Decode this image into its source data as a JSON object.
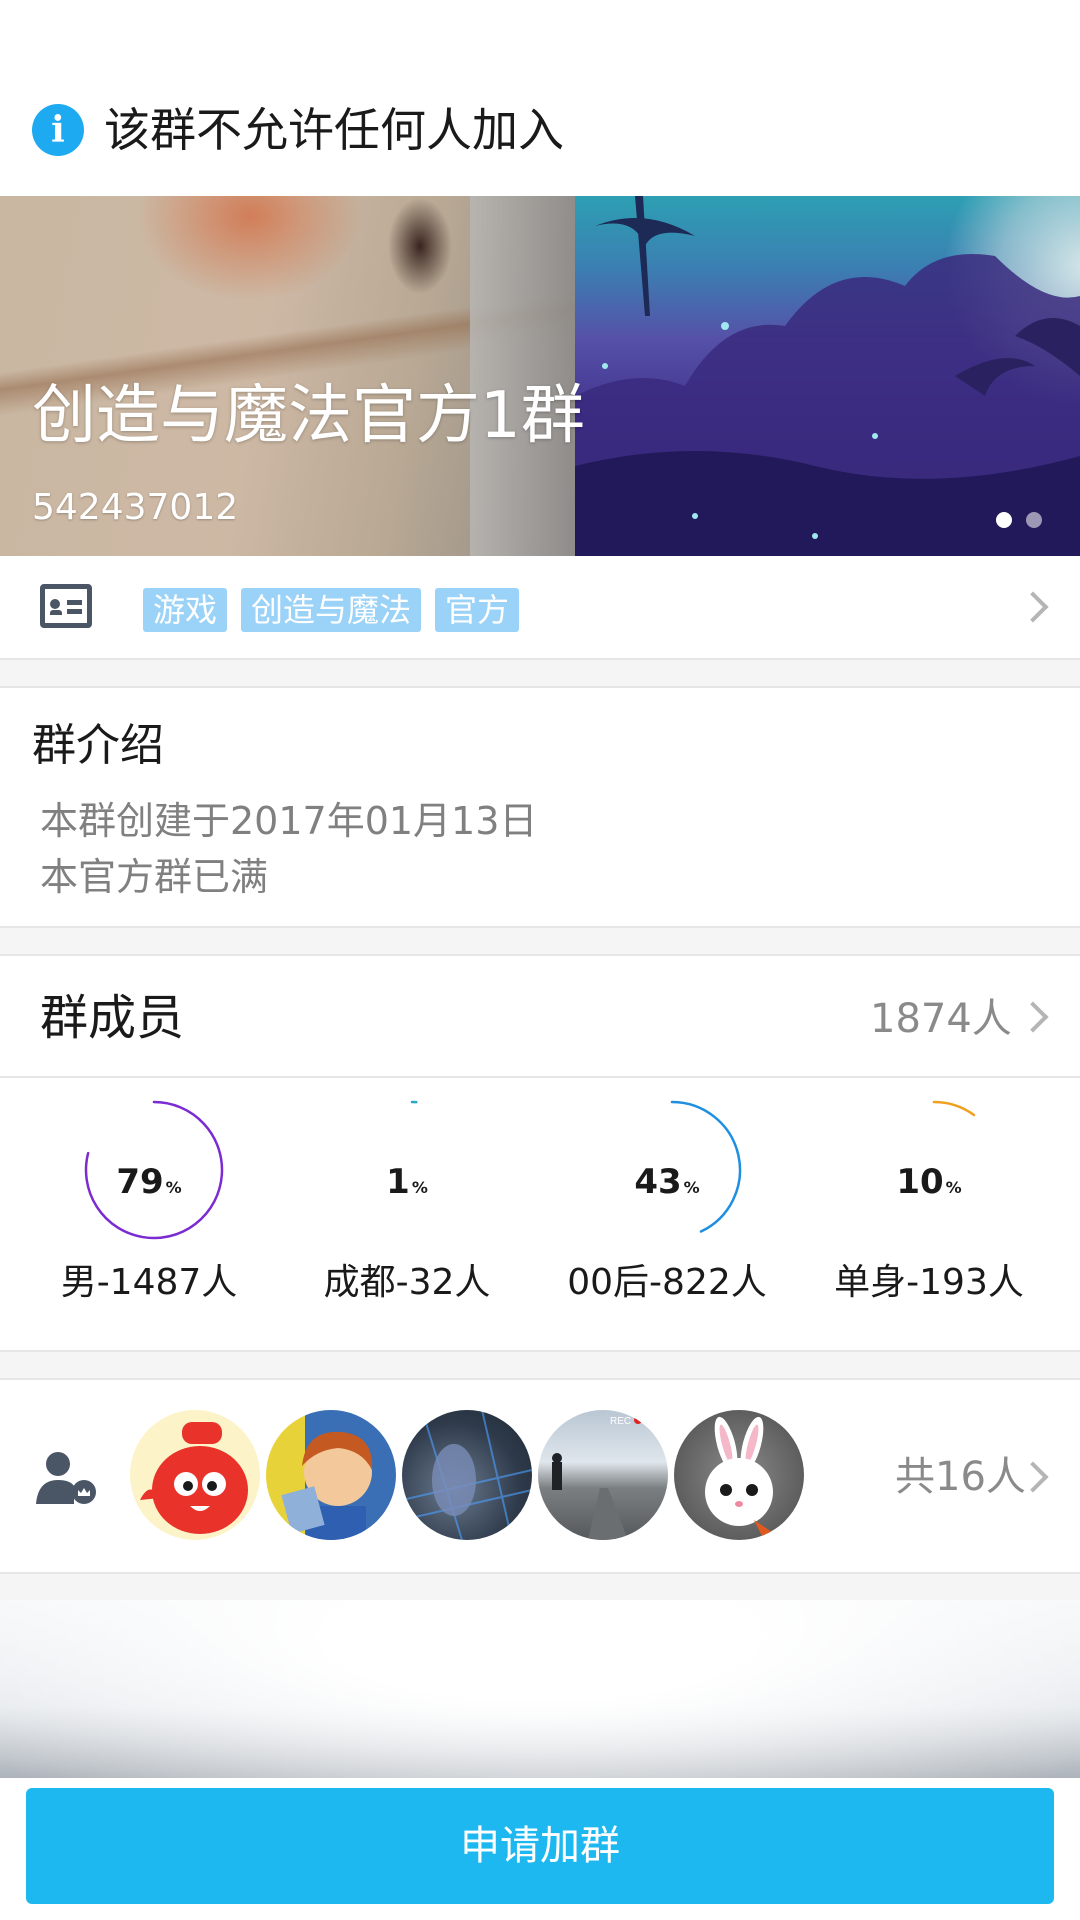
{
  "notice": {
    "icon": "info-icon",
    "text": "该群不允许任何人加入"
  },
  "hero": {
    "group_name": "创造与魔法官方1群",
    "group_id": "542437012",
    "slide_count": 2,
    "active_slide": 1
  },
  "tags": {
    "icon": "id-card-icon",
    "items": [
      "游戏",
      "创造与魔法",
      "官方"
    ]
  },
  "intro": {
    "title": "群介绍",
    "lines": [
      "本群创建于2017年01月13日",
      "本官方群已满"
    ]
  },
  "members": {
    "title": "群成员",
    "count": "1874人",
    "stats": [
      {
        "value": "79",
        "unit": "%",
        "label": "男-1487人",
        "color": "#7a2bd1",
        "fraction": 0.79
      },
      {
        "value": "1",
        "unit": "%",
        "label": "成都-32人",
        "color": "#2aa8c8",
        "fraction": 0.01
      },
      {
        "value": "43",
        "unit": "%",
        "label": "00后-822人",
        "color": "#1f8fe0",
        "fraction": 0.43
      },
      {
        "value": "10",
        "unit": "%",
        "label": "单身-193人",
        "color": "#f0a020",
        "fraction": 0.1
      }
    ]
  },
  "admins": {
    "icon": "admin-user-icon",
    "count": "共16人"
  },
  "actions": {
    "join_label": "申请加群"
  },
  "colors": {
    "accent": "#1db8f0",
    "tag_bg": "#9bd2f7"
  }
}
